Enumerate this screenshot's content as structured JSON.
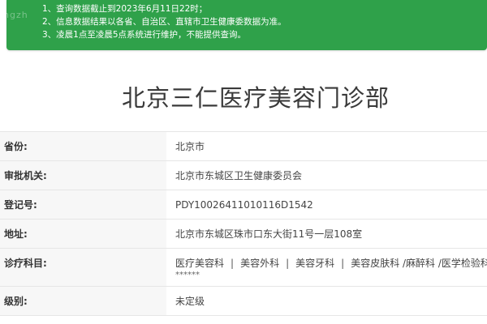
{
  "notice": {
    "watermark": "ngzh",
    "lines": [
      "1、查询数据截止到2023年6月11日22时；",
      "2、信息数据结果以各省、自治区、直辖市卫生健康委数据为准。",
      "3、凌晨1点至凌晨5点系统进行维护，不能提供查询。"
    ],
    "color": "#2fa14a"
  },
  "title": "北京三仁医疗美容门诊部",
  "fields": {
    "province": {
      "label": "省份:",
      "value": "北京市"
    },
    "authority": {
      "label": "审批机关:",
      "value": "北京市东城区卫生健康委员会"
    },
    "registration": {
      "label": "登记号:",
      "value": "PDY10026411010116D1542"
    },
    "address": {
      "label": "地址:",
      "value": "北京市东城区珠市口东大街11号一层108室"
    },
    "departments": {
      "label": "诊疗科目:",
      "items": [
        "医疗美容科",
        "美容外科",
        "美容牙科",
        "美容皮肤科 /麻醉科 /医学检验科"
      ],
      "separator": "|",
      "extra": "******"
    },
    "level": {
      "label": "级别:",
      "value": "未定级"
    }
  }
}
